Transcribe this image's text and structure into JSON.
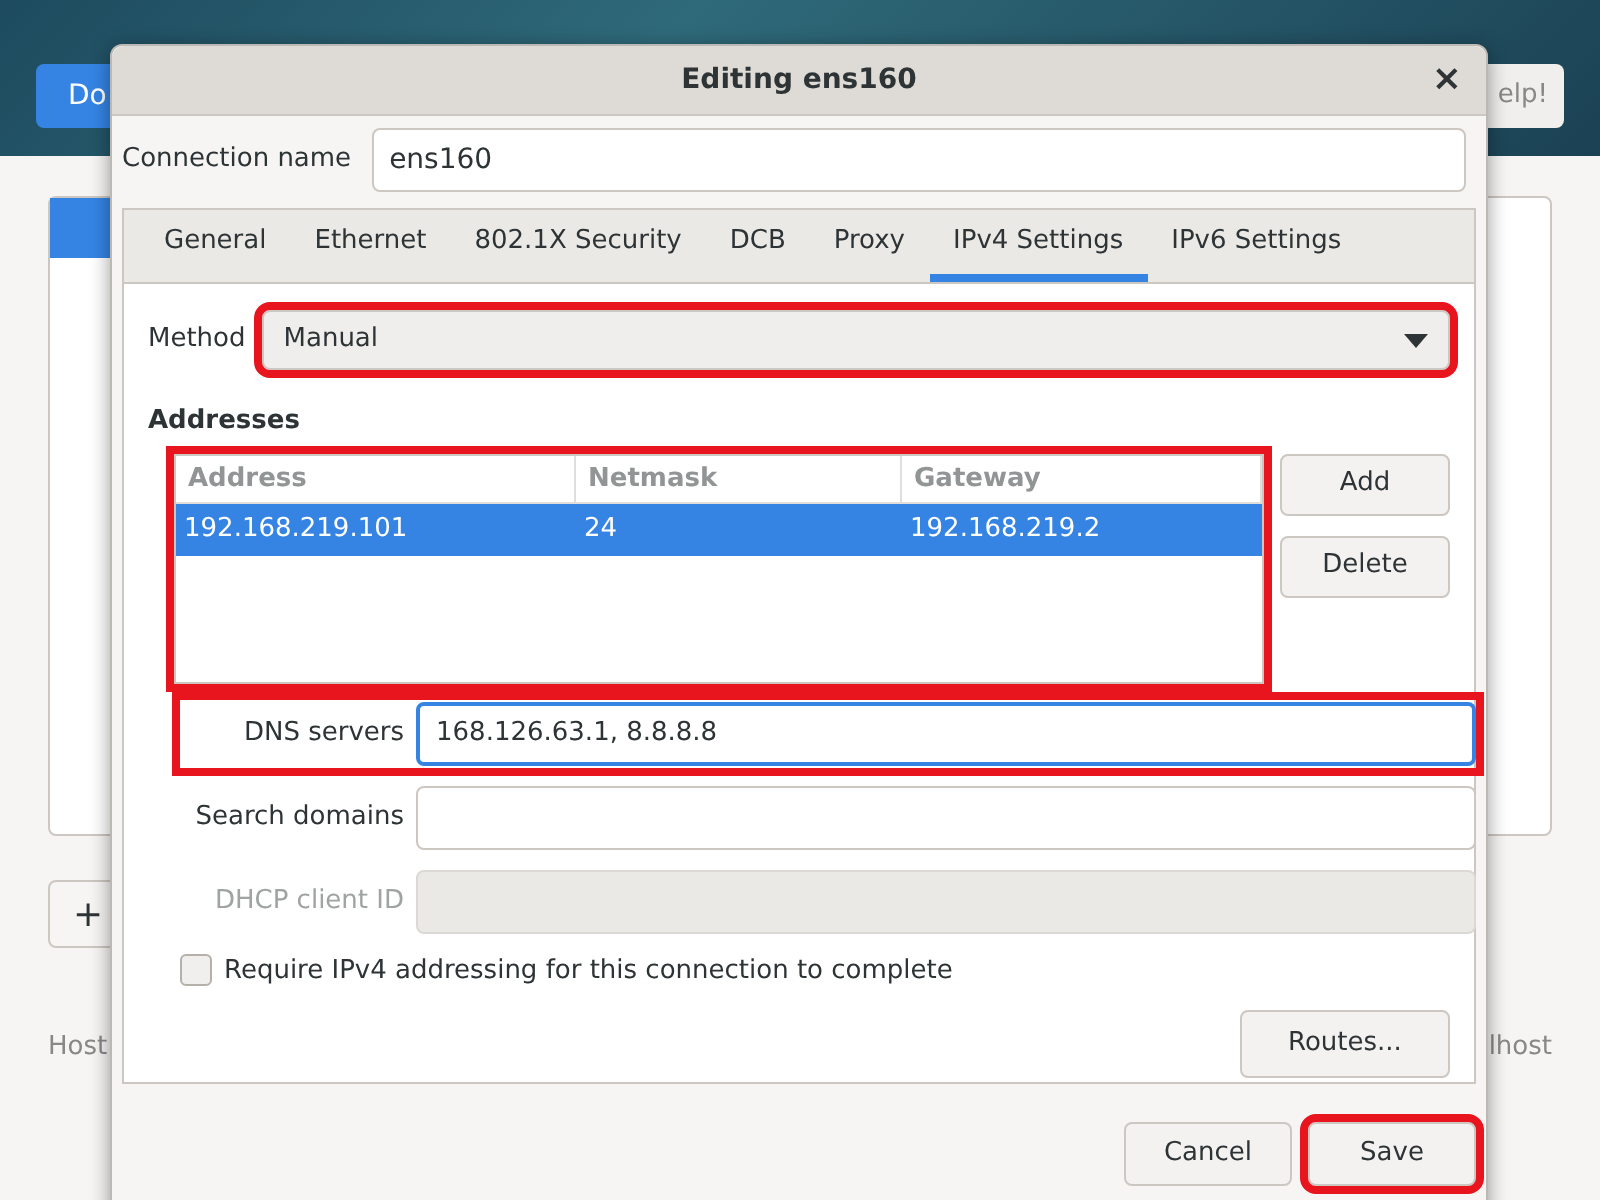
{
  "background": {
    "done_button": "Do",
    "help_button": "elp!",
    "add_button": "+",
    "host_label": "Host",
    "host_value": "lhost"
  },
  "dialog": {
    "title": "Editing ens160",
    "close": "×",
    "connection_name": {
      "label": "Connection name",
      "value": "ens160"
    },
    "tabs": [
      {
        "label": "General",
        "selected": false
      },
      {
        "label": "Ethernet",
        "selected": false
      },
      {
        "label": "802.1X Security",
        "selected": false
      },
      {
        "label": "DCB",
        "selected": false
      },
      {
        "label": "Proxy",
        "selected": false
      },
      {
        "label": "IPv4 Settings",
        "selected": true
      },
      {
        "label": "IPv6 Settings",
        "selected": false
      }
    ],
    "method": {
      "label": "Method",
      "value": "Manual",
      "highlighted": true
    },
    "addresses": {
      "title": "Addresses",
      "highlighted": true,
      "columns": [
        "Address",
        "Netmask",
        "Gateway"
      ],
      "rows": [
        {
          "cells": [
            "192.168.219.101",
            "24",
            "192.168.219.2"
          ],
          "selected": true
        }
      ],
      "buttons": [
        "Add",
        "Delete"
      ]
    },
    "fields": [
      {
        "label": "DNS servers",
        "value": "168.126.63.1, 8.8.8.8",
        "focused": true,
        "disabled": false,
        "highlighted": true
      },
      {
        "label": "Search domains",
        "focused": false,
        "disabled": false,
        "highlighted": false
      },
      {
        "label": "DHCP client ID",
        "focused": false,
        "disabled": true,
        "highlighted": false
      }
    ],
    "require": {
      "label": "Require IPv4 addressing for this connection to complete",
      "checked": false
    },
    "routes_button": "Routes...",
    "buttons": [
      {
        "label": "Cancel",
        "highlighted": false
      },
      {
        "label": "Save",
        "highlighted": true
      }
    ]
  }
}
